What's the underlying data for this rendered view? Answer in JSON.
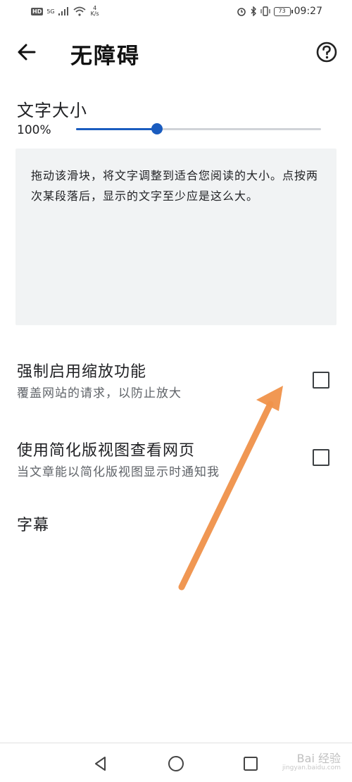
{
  "status_bar": {
    "hd": "HD",
    "network": "5G",
    "speed_value": "4",
    "speed_unit": "K/s",
    "battery": "73",
    "time": "09:27"
  },
  "header": {
    "title": "无障碍",
    "back_icon": "arrow-back-icon",
    "help_icon": "help-circle-icon"
  },
  "text_size": {
    "label": "文字大小",
    "value": "100%",
    "slider_fraction": 0.33,
    "preview": "拖动该滑块，将文字调整到适合您阅读的大小。点按两次某段落后，显示的文字至少应是这么大。"
  },
  "settings": [
    {
      "title": "强制启用缩放功能",
      "summary": "覆盖网站的请求，以防止放大",
      "checked": false
    },
    {
      "title": "使用简化版视图查看网页",
      "summary": "当文章能以简化版视图显示时通知我",
      "checked": false
    }
  ],
  "captions": {
    "label": "字幕"
  },
  "watermark": {
    "text": "Bai 经验",
    "sub": "jingyan.baidu.com"
  },
  "colors": {
    "accent": "#1a5cbf",
    "preview_bg": "#f1f3f4",
    "annotation_arrow": "#f0924a"
  }
}
